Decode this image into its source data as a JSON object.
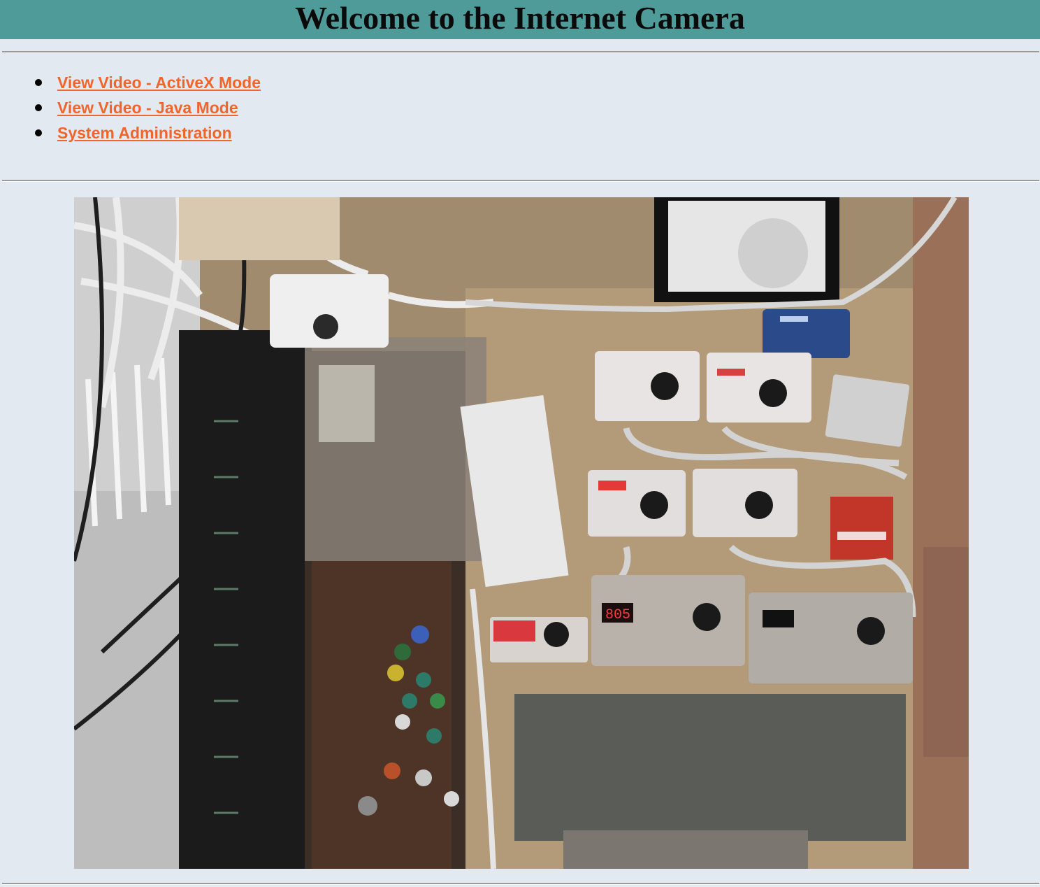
{
  "header": {
    "title": "Welcome to the Internet Camera",
    "background_color": "#4e9b99"
  },
  "nav": {
    "links": [
      {
        "label": "View Video - ActiveX Mode"
      },
      {
        "label": "View Video - Java Mode"
      },
      {
        "label": "System Administration"
      }
    ],
    "link_color": "#f2652a"
  },
  "camera": {
    "image_name": "camera-snapshot",
    "display_1": "805"
  },
  "colors": {
    "page_background": "#e3e9f0"
  }
}
